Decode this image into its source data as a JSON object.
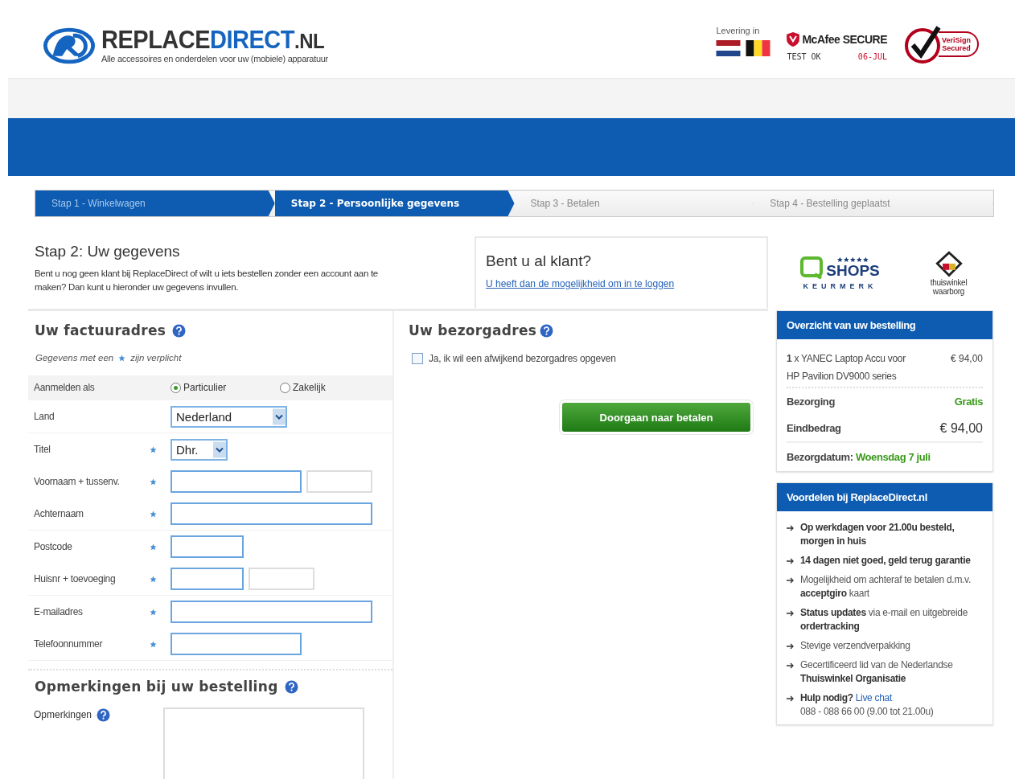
{
  "header": {
    "logo": {
      "part_1": "REPLACE",
      "part_2": "DIRECT",
      "suffix": ".NL",
      "tagline": "Alle accessoires en onderdelen voor uw (mobiele) apparatuur"
    },
    "delivery": {
      "label": "Levering in"
    },
    "mcafee": {
      "title": "McAfee SECURE",
      "status": "TEST OK",
      "date": "06-JUL"
    },
    "verisign": {
      "label_1": "VeriSign",
      "label_2": "Secured"
    }
  },
  "steps": [
    {
      "label": "Stap 1 - Winkelwagen",
      "completed": true,
      "selected": false
    },
    {
      "label": "Stap 2 - Persoonlijke gegevens",
      "completed": true,
      "selected": true
    },
    {
      "label": "Stap 3 - Betalen",
      "completed": false,
      "selected": false
    },
    {
      "label": "Stap 4 - Bestelling geplaatst",
      "completed": false,
      "selected": false
    }
  ],
  "intro": {
    "title": "Stap 2: Uw gegevens",
    "text": "Bent u nog geen klant bij ReplaceDirect of wilt u iets bestellen zonder een account aan te maken? Dan kunt u hieronder uw gegevens invullen."
  },
  "login": {
    "title": "Bent u al klant?",
    "link": "U heeft dan de mogelijkheid om in te loggen"
  },
  "badges": {
    "keurmerk_title": "SHOPS",
    "keurmerk_sub": "KEURMERK",
    "thuiswinkel": "thuiswinkel waarborg"
  },
  "billing": {
    "title": "Uw factuuradres",
    "required_note_1": "Gegevens met een",
    "required_note_2": "zijn verplicht",
    "groups": [
      {
        "rows": [
          {
            "kind": "radio",
            "label": "Aanmelden als",
            "required": false,
            "options": [
              {
                "label": "Particulier",
                "selected": true
              },
              {
                "label": "Zakelijk",
                "selected": false
              }
            ]
          }
        ]
      },
      {
        "rows": [
          {
            "kind": "select",
            "label": "Land",
            "required": false,
            "inputs": [
              {
                "kind": "medium",
                "value": "Nederland"
              }
            ]
          }
        ]
      },
      {
        "rows": [
          {
            "kind": "select",
            "label": "Titel",
            "required": true,
            "inputs": [
              {
                "kind": "short",
                "value": "Dhr."
              }
            ]
          },
          {
            "kind": "text",
            "label": "Voornaam + tussenv.",
            "required": true,
            "inputs": [
              {
                "kind": "medium",
                "required": true
              },
              {
                "kind": "small",
                "required": false
              }
            ]
          },
          {
            "kind": "text",
            "label": "Achternaam",
            "required": true,
            "inputs": [
              {
                "kind": "large",
                "required": true
              }
            ]
          }
        ]
      },
      {
        "rows": [
          {
            "kind": "text",
            "label": "Postcode",
            "required": true,
            "inputs": [
              {
                "kind": "short",
                "required": true
              }
            ]
          },
          {
            "kind": "text",
            "label": "Huisnr + toevoeging",
            "required": true,
            "inputs": [
              {
                "kind": "short",
                "required": true
              },
              {
                "kind": "small",
                "required": false
              }
            ]
          }
        ]
      },
      {
        "rows": [
          {
            "kind": "text",
            "label": "E-mailadres",
            "required": true,
            "inputs": [
              {
                "kind": "large",
                "required": true
              }
            ]
          },
          {
            "kind": "text",
            "label": "Telefoonnummer",
            "required": true,
            "inputs": [
              {
                "kind": "medium",
                "required": true
              }
            ]
          }
        ]
      }
    ]
  },
  "remarks": {
    "title": "Opmerkingen bij uw bestelling",
    "label": "Opmerkingen"
  },
  "delivery_address": {
    "title": "Uw bezorgadres",
    "checkbox": {
      "label": "Ja, ik wil een afwijkend bezorgadres opgeven",
      "checked": false
    },
    "button": "Doorgaan naar betalen"
  },
  "order": {
    "title": "Overzicht van uw bestelling",
    "item": {
      "text": "**1** x YANEC Laptop Accu voor HP Pavilion DV9000 series",
      "price": "€ 94,00"
    },
    "shipping": {
      "label": "Bezorging",
      "value": "Gratis"
    },
    "total": {
      "label": "Eindbedrag",
      "value": "€ 94,00"
    },
    "date": {
      "label": "Bezorgdatum:",
      "value": "Woensdag 7 juli"
    }
  },
  "benefits": {
    "title": "Voordelen bij ReplaceDirect.nl",
    "items": [
      {
        "kind": "text",
        "text": "**Op werkdagen voor 21.00u besteld, morgen in huis**"
      },
      {
        "kind": "text",
        "text": "**14 dagen niet goed, geld terug garantie**"
      },
      {
        "kind": "text",
        "text": "Mogelijkheid om achteraf te betalen d.m.v. **acceptgiro** kaart"
      },
      {
        "kind": "text",
        "text": "**Status updates** via e-mail en uitgebreide **ordertracking**"
      },
      {
        "kind": "text",
        "text": "Stevige verzendverpakking"
      },
      {
        "kind": "text",
        "text": "Gecertificeerd lid van de Nederlandse **Thuiswinkel Organisatie**"
      },
      {
        "kind": "help",
        "text": "**Hulp nodig?**",
        "link": "Live chat",
        "note": "088 - 088 66 00 (9.00 tot 21.00u)"
      }
    ]
  }
}
